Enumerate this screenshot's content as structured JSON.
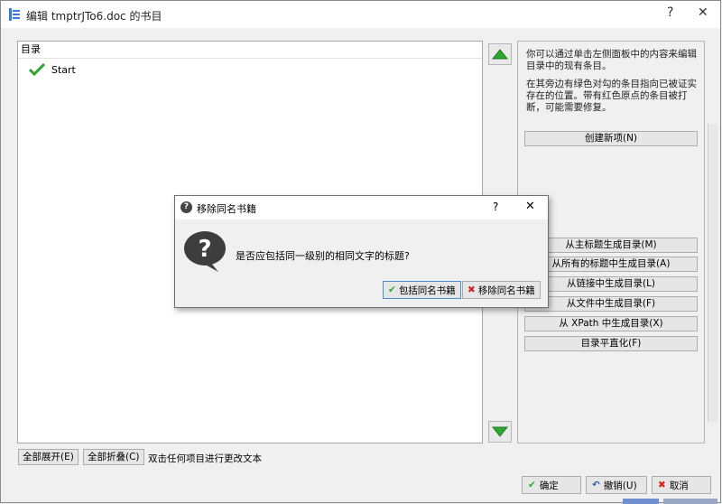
{
  "window": {
    "title": "编辑 tmptrJTo6.doc 的书目",
    "help": "?",
    "close": "✕"
  },
  "tree": {
    "header": "目录",
    "items": [
      {
        "label": "Start"
      }
    ]
  },
  "help_text": {
    "para1": "你可以通过单击左侧面板中的内容来编辑目录中的现有条目。",
    "para2": "在其旁边有绿色对勾的条目指向已被证实存在的位置。带有红色原点的条目被打断，可能需要修复。"
  },
  "right_buttons": {
    "create_new": "创建新项(N)",
    "from_headings": "从主标题生成目录(M)",
    "from_all_headings": "从所有的标题中生成目录(A)",
    "from_links": "从链接中生成目录(L)",
    "from_files": "从文件中生成目录(F)",
    "from_xpath": "从 XPath 中生成目录(X)",
    "flatten": "目录平直化(F)"
  },
  "bottom": {
    "expand_all": "全部展开(E)",
    "collapse_all": "全部折叠(C)",
    "hint": "双击任何项目进行更改文本",
    "ok": "确定",
    "undo": "撤销(U)",
    "cancel": "取消"
  },
  "dialog": {
    "title": "移除同名书籍",
    "help": "?",
    "close": "✕",
    "message": "是否应包括同一级别的相同文字的标题?",
    "include": "包括同名书籍",
    "remove": "移除同名书籍"
  },
  "colors": {
    "accent_green": "#2ea52e",
    "cancel_red": "#d22222",
    "default_border": "#4a8fd6"
  }
}
